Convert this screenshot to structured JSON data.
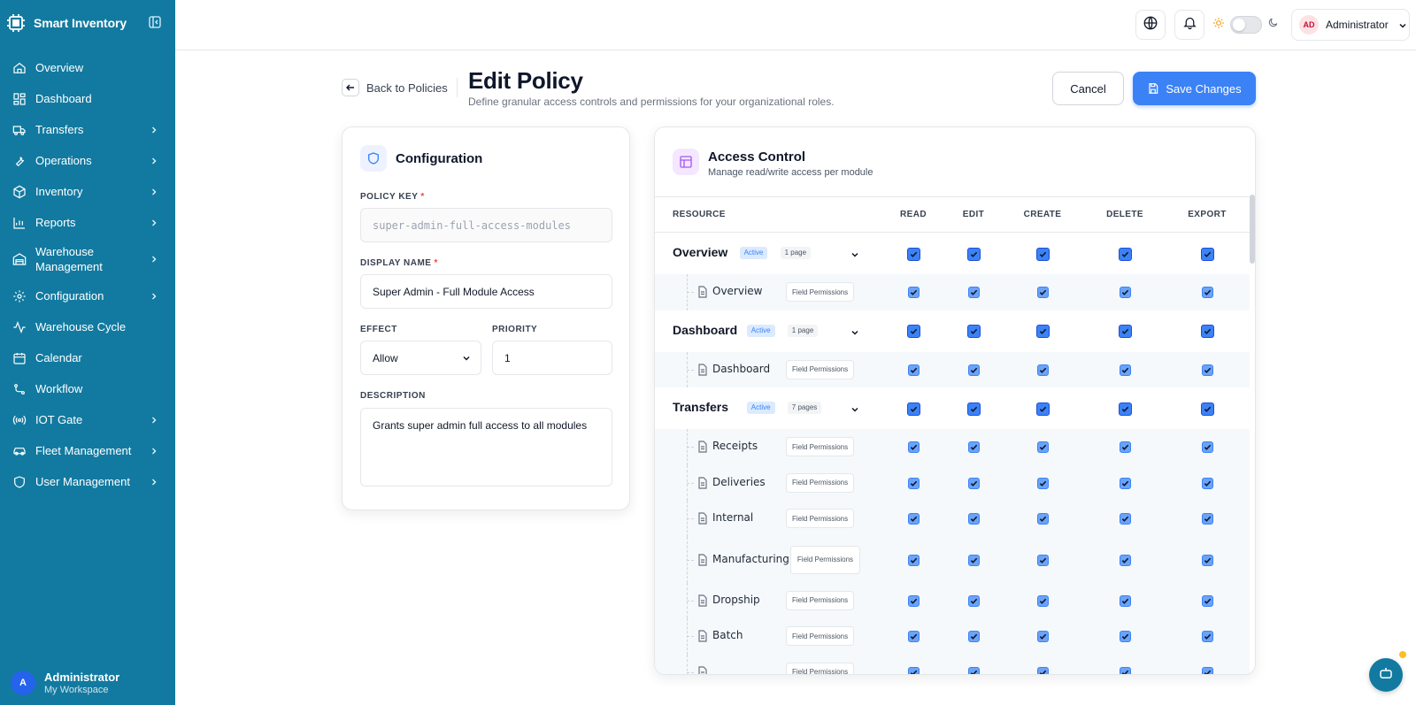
{
  "app": {
    "name": "Smart Inventory"
  },
  "sidebar": {
    "items": [
      {
        "label": "Overview",
        "icon": "home-icon",
        "chevron": false
      },
      {
        "label": "Dashboard",
        "icon": "dashboard-icon",
        "chevron": false
      },
      {
        "label": "Transfers",
        "icon": "truck-icon",
        "chevron": true
      },
      {
        "label": "Operations",
        "icon": "wrench-icon",
        "chevron": true
      },
      {
        "label": "Inventory",
        "icon": "box-icon",
        "chevron": true
      },
      {
        "label": "Reports",
        "icon": "bar-chart-icon",
        "chevron": true
      },
      {
        "label": "Warehouse Management",
        "icon": "warehouse-icon",
        "chevron": true
      },
      {
        "label": "Configuration",
        "icon": "gear-icon",
        "chevron": true
      },
      {
        "label": "Warehouse Cycle",
        "icon": "activity-icon",
        "chevron": false
      },
      {
        "label": "Calendar",
        "icon": "calendar-icon",
        "chevron": false
      },
      {
        "label": "Workflow",
        "icon": "workflow-icon",
        "chevron": false
      },
      {
        "label": "IOT Gate",
        "icon": "radio-icon",
        "chevron": true
      },
      {
        "label": "Fleet Management",
        "icon": "car-icon",
        "chevron": true
      },
      {
        "label": "User Management",
        "icon": "shield-icon",
        "chevron": true
      }
    ],
    "user": {
      "initial": "A",
      "name": "Administrator",
      "workspace": "My Workspace"
    }
  },
  "topbar": {
    "admin_initials": "AD",
    "admin_name": "Administrator"
  },
  "header": {
    "back_label": "Back to Policies",
    "title": "Edit Policy",
    "subtitle": "Define granular access controls and permissions for your organizational roles.",
    "cancel_label": "Cancel",
    "save_label": "Save Changes"
  },
  "config": {
    "title": "Configuration",
    "policy_key_label": "POLICY KEY",
    "policy_key_value": "super-admin-full-access-modules",
    "display_name_label": "DISPLAY NAME",
    "display_name_value": "Super Admin - Full Module Access",
    "effect_label": "EFFECT",
    "effect_value": "Allow",
    "priority_label": "PRIORITY",
    "priority_value": "1",
    "description_label": "DESCRIPTION",
    "description_value": "Grants super admin full access to all modules",
    "required_mark": "*"
  },
  "access": {
    "title": "Access Control",
    "subtitle": "Manage read/write access per module",
    "columns": [
      "RESOURCE",
      "READ",
      "EDIT",
      "CREATE",
      "DELETE",
      "EXPORT"
    ],
    "field_permissions_label": "Field Permissions",
    "rows": [
      {
        "type": "module",
        "name": "Overview",
        "status": "Active",
        "pages": "1 page"
      },
      {
        "type": "page",
        "name": "Overview"
      },
      {
        "type": "module",
        "name": "Dashboard",
        "status": "Active",
        "pages": "1 page"
      },
      {
        "type": "page",
        "name": "Dashboard"
      },
      {
        "type": "module",
        "name": "Transfers",
        "status": "Active",
        "pages": "7 pages"
      },
      {
        "type": "page",
        "name": "Receipts"
      },
      {
        "type": "page",
        "name": "Deliveries"
      },
      {
        "type": "page",
        "name": "Internal"
      },
      {
        "type": "page",
        "name": "Manufacturing",
        "wrap": true
      },
      {
        "type": "page",
        "name": "Dropship"
      },
      {
        "type": "page",
        "name": "Batch"
      },
      {
        "type": "page",
        "name": ""
      }
    ]
  },
  "colors": {
    "sidebar": "#127aa0",
    "accent": "#3b82f6"
  }
}
